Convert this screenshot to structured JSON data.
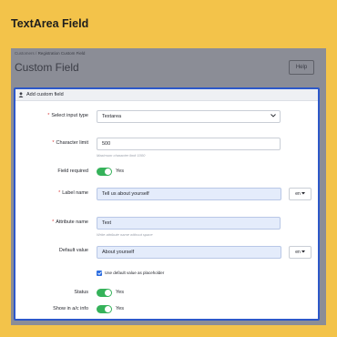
{
  "promo": {
    "title": "TextArea Field"
  },
  "breadcrumb": {
    "parent": "Customers",
    "separator": "/",
    "current": "Registration Custom Field"
  },
  "page": {
    "title": "Custom Field",
    "help_label": "Help"
  },
  "panel": {
    "title": "Add custom field"
  },
  "form": {
    "input_type": {
      "label": "Select input type",
      "value": "Textarea"
    },
    "char_limit": {
      "label": "Character limit",
      "value": "500",
      "hint": "Maximum character limit 1000"
    },
    "required": {
      "label": "Field required",
      "state": "Yes"
    },
    "label_name": {
      "label": "Label name",
      "value": "Tell us about yourself",
      "lang": "en"
    },
    "attribute_name": {
      "label": "Attribute name",
      "value": "Text",
      "hint": "Write attribute name without space"
    },
    "default_value": {
      "label": "Default value",
      "value": "About yourself",
      "lang": "en"
    },
    "placeholder_checkbox": {
      "label": "Use default value as placeholder"
    },
    "status": {
      "label": "Status",
      "state": "Yes"
    },
    "show_in_account": {
      "label": "Show in a/c info",
      "state": "Yes"
    }
  },
  "colors": {
    "background": "#f3c34a",
    "accent": "#2d58c9",
    "toggle_on": "#35b25a",
    "required": "#d83b3b"
  }
}
